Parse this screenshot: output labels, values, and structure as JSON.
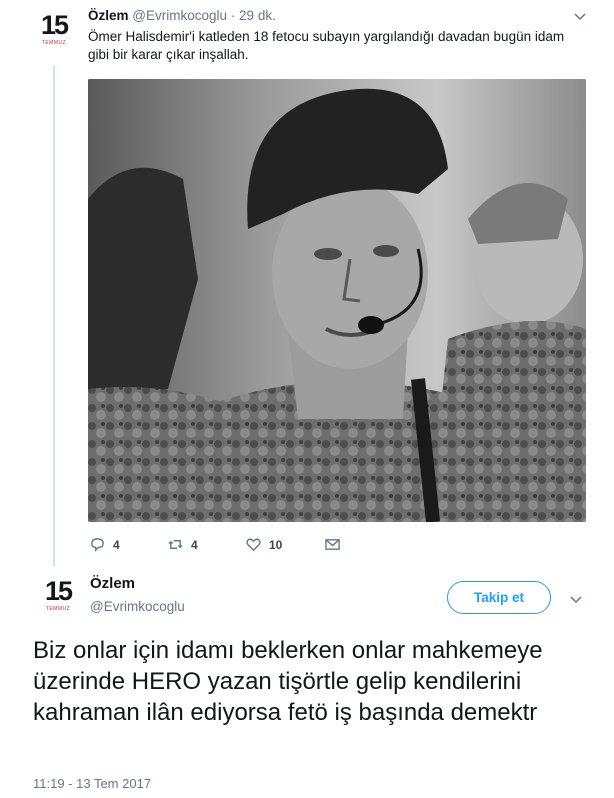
{
  "brand": {
    "logo_number": "15",
    "logo_sub": "TEMMUZ",
    "accent_color": "#d7262b",
    "link_color": "#1da1f2",
    "thread_color": "#c6e3f7"
  },
  "quoted_tweet": {
    "name": "Özlem",
    "handle": "@Evrimkocoglu",
    "separator": "·",
    "time": "29 dk.",
    "text": "Ömer Halisdemir'i katleden 18 fetocu subayın yargılandığı davadan bugün idam gibi bir karar çıkar inşallah.",
    "actions": {
      "reply_count": "4",
      "retweet_count": "4",
      "like_count": "10"
    },
    "menu_icon": "chevron-down-icon"
  },
  "main_tweet": {
    "name": "Özlem",
    "handle": "@Evrimkocoglu",
    "follow_label": "Takip et",
    "text": "Biz onlar için idamı beklerken onlar mahkemeye üzerinde HERO yazan tişörtle gelip kendilerini kahraman ilân ediyorsa fetö iş başında demektr",
    "timestamp": "11:19 - 13 Tem 2017",
    "menu_icon": "chevron-down-icon"
  }
}
